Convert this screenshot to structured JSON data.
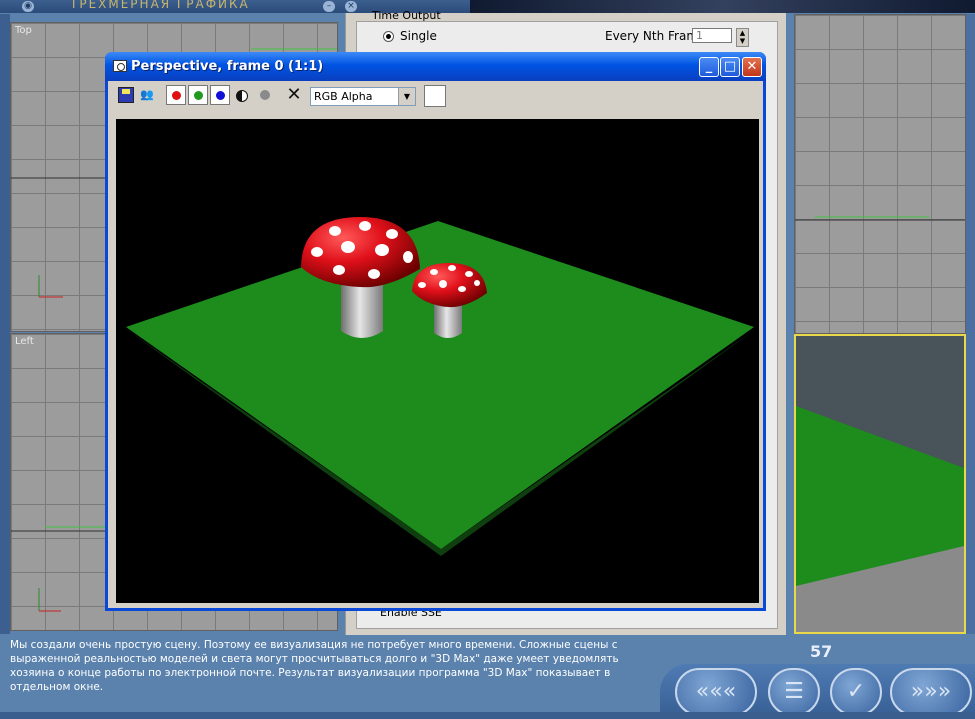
{
  "app": {
    "title": "ТРЕХМЕРНАЯ ГРАФИКА"
  },
  "viewports": {
    "top_label": "Top",
    "left_label": "Left"
  },
  "render_settings": {
    "time_output_label": "Time Output",
    "single_label": "Single",
    "every_nth_label": "Every Nth Frame:",
    "every_nth_value": "1",
    "enable_sub_label": "Enable SSE"
  },
  "render_window": {
    "title": "Perspective, frame 0 (1:1)",
    "minimize_glyph": "_",
    "maximize_glyph": "□",
    "close_glyph": "✕",
    "channel_select_value": "RGB Alpha",
    "clear_glyph": "✕",
    "clone_glyph": "👥",
    "colors": {
      "ground": "#1d8c1d",
      "cap": "#e0101a",
      "stem": "#b8b8b8",
      "background": "#000000"
    }
  },
  "info": {
    "text": "Мы создали очень простую сцену. Поэтому ее визуализация не потребует много времени. Сложные сцены с выраженной реальностью моделей и света могут просчитываться долго и \"3D Max\" даже умеет уведомлять хозяина о конце работы по электронной почте. Результат визуализации программа \"3D Max\" показывает в отдельном окне.",
    "page_number": "57"
  },
  "nav": {
    "prev_glyph": "«««",
    "menu_glyph": "☰",
    "ok_glyph": "✓",
    "next_glyph": "»»»"
  }
}
